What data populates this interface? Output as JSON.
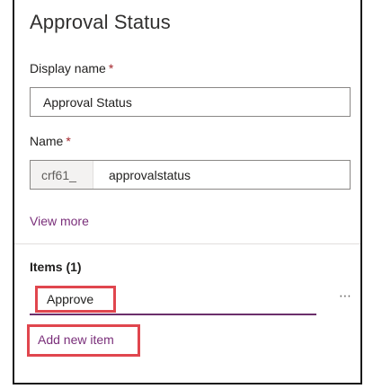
{
  "panel": {
    "title": "Approval Status"
  },
  "display_name": {
    "label": "Display name",
    "required_mark": "*",
    "value": "Approval Status"
  },
  "name": {
    "label": "Name",
    "required_mark": "*",
    "prefix": "crf61_",
    "value": "approvalstatus"
  },
  "view_more": {
    "label": "View more"
  },
  "items": {
    "label": "Items (1)",
    "list": [
      {
        "value": "Approve"
      }
    ],
    "more_icon": "more-horizontal-icon",
    "add_label": "Add new item"
  },
  "colors": {
    "link": "#7a2f7a",
    "required": "#a4262c",
    "highlight": "#e0464e",
    "underline": "#6b2f6b"
  }
}
